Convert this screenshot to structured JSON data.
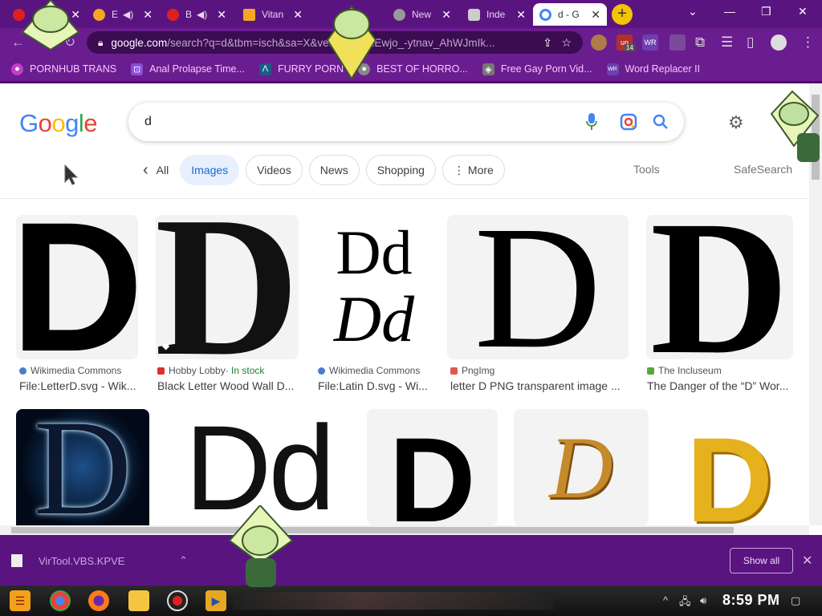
{
  "browser": {
    "tabs": [
      {
        "label": "",
        "fav_color": "#e02020"
      },
      {
        "label": "E",
        "fav_color": "#f5a623"
      },
      {
        "label": "B",
        "fav_color": "#e02020"
      },
      {
        "label": "Vitan",
        "fav_color": "#f5a623"
      },
      {
        "label": "New",
        "fav_color": "#999999"
      },
      {
        "label": "Inde",
        "fav_color": "#cccccc"
      },
      {
        "label": "d - G",
        "fav_color": "#4285f4",
        "active": true
      }
    ],
    "new_tab_label": "+",
    "close_glyph": "✕",
    "url_host": "google.com",
    "url_path": "/search?q=d&tbm=isch&sa=X&ved=0ahUKEwjo_-ytnav_AhWJmIk...",
    "ext_badge_un": "un",
    "ext_badge_count": "14"
  },
  "bookmarks": [
    {
      "label": "PORNHUB TRANS",
      "icon_color": "#c13ecb",
      "glyph": "●"
    },
    {
      "label": "Anal Prolapse Time...",
      "icon_color": "#8a4fd8",
      "glyph": "⊡"
    },
    {
      "label": "FURRY PORN",
      "icon_color": "#1a5d8a",
      "glyph": "Λ"
    },
    {
      "label": "BEST OF HORRO...",
      "icon_color": "#888888",
      "glyph": "●"
    },
    {
      "label": "Free Gay Porn Vid...",
      "icon_color": "#777777",
      "glyph": "◈"
    },
    {
      "label": "Word Replacer II",
      "icon_color": "#6d3fb0",
      "glyph": "WR"
    }
  ],
  "google": {
    "logo": [
      "G",
      "o",
      "o",
      "g",
      "l",
      "e"
    ],
    "logo_colors": [
      "#4285f4",
      "#ea4335",
      "#fbbc05",
      "#4285f4",
      "#34a853",
      "#ea4335"
    ],
    "query": "d",
    "chips": {
      "back": "‹",
      "all": "All",
      "images": "Images",
      "videos": "Videos",
      "news": "News",
      "shopping": "Shopping",
      "more": "More"
    },
    "tools": "Tools",
    "safesearch": "SafeSearch"
  },
  "results_row1": [
    {
      "source": "Wikimedia Commons",
      "title": "File:LetterD.svg - Wik...",
      "src_color": "#4a7dc9"
    },
    {
      "source": "Hobby Lobby",
      "stock": " · In stock",
      "title": "Black Letter Wood Wall D...",
      "src_color": "#d9302c"
    },
    {
      "source": "Wikimedia Commons",
      "title": "File:Latin D.svg - Wi...",
      "src_color": "#4a7dc9"
    },
    {
      "source": "PngImg",
      "title": "letter D PNG transparent image ...",
      "src_color": "#e05a4a"
    },
    {
      "source": "The Incluseum",
      "title": "The Danger of the “D” Wor...",
      "src_color": "#5ba43c"
    }
  ],
  "thumb_text": {
    "big_d": "D",
    "dd_upright": "Dd",
    "dd_italic": "Dd",
    "d_script": "D"
  },
  "downloads": {
    "file": "VirTool.VBS.KPVE",
    "show_all": "Show all",
    "close": "✕"
  },
  "taskbar": {
    "clock": "8:59 PM"
  }
}
